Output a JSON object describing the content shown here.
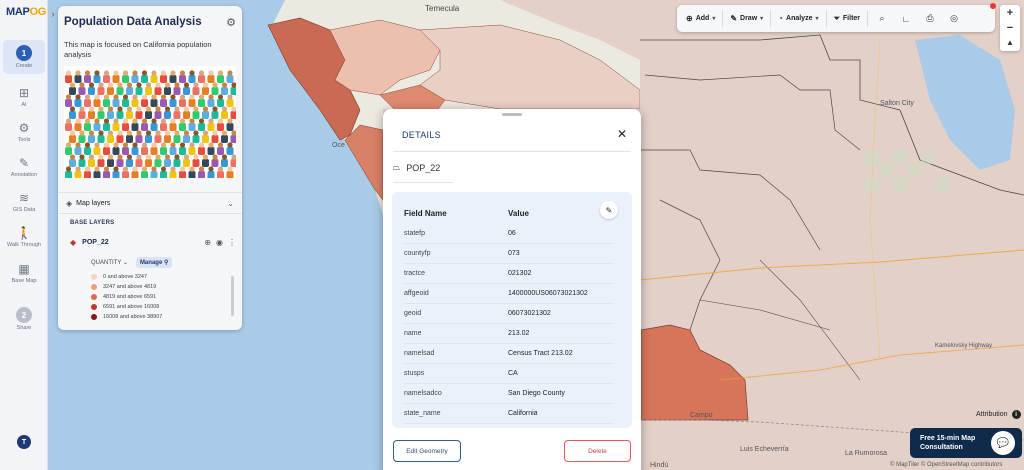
{
  "app": {
    "logo_main": "MAP",
    "logo_accent": "OG"
  },
  "rail": {
    "expand_icon": "chevron-right-icon",
    "items": [
      {
        "label": "Create",
        "step": "1"
      },
      {
        "label": "AI"
      },
      {
        "label": "Tools"
      },
      {
        "label": "Annotation"
      },
      {
        "label": "GIS Data"
      },
      {
        "label": "Walk Through"
      },
      {
        "label": "Base Map"
      },
      {
        "label": "Share",
        "step": "2"
      }
    ],
    "user_initial": "T"
  },
  "panel": {
    "title": "Population Data Analysis",
    "description": "This map is focused on California population analysis",
    "map_layers_label": "Map layers",
    "base_layers_label": "BASE LAYERS",
    "layer_name": "POP_22",
    "style_mode": "QUANTITY",
    "manage_label": "Manage",
    "legend": [
      {
        "label": "0 and above 3247",
        "color": "#f6d4c6"
      },
      {
        "label": "3247 and above 4819",
        "color": "#ee9e80"
      },
      {
        "label": "4819 and above 6591",
        "color": "#df6a4c"
      },
      {
        "label": "6591 and above 16008",
        "color": "#c0392b"
      },
      {
        "label": "16008 and above 38907",
        "color": "#8e1515"
      }
    ]
  },
  "toolbar": {
    "add_label": "Add",
    "draw_label": "Draw",
    "analyze_label": "Analyze",
    "filter_label": "Filter"
  },
  "zoom": {
    "in": "+",
    "out": "−"
  },
  "map_labels": {
    "temecula": "Temecula",
    "salton_city": "Salton City",
    "kamelovsky": "Kamelovsky Highway",
    "campo": "Campo",
    "luis_echeverria": "Luis Echeverría",
    "la_rumorosa": "La Rumorosa",
    "hindu": "Hindú",
    "oce": "Oce"
  },
  "details": {
    "title": "DETAILS",
    "feature_name": "POP_22",
    "col_field": "Field Name",
    "col_value": "Value",
    "rows": [
      {
        "field": "statefp",
        "value": "06"
      },
      {
        "field": "countyfp",
        "value": "073"
      },
      {
        "field": "tractce",
        "value": "021302"
      },
      {
        "field": "affgeoid",
        "value": "1400000US06073021302"
      },
      {
        "field": "geoid",
        "value": "06073021302"
      },
      {
        "field": "name",
        "value": "213.02"
      },
      {
        "field": "namelsad",
        "value": "Census Tract 213.02"
      },
      {
        "field": "stusps",
        "value": "CA"
      },
      {
        "field": "namelsadco",
        "value": "San Diego County"
      },
      {
        "field": "state_name",
        "value": "California"
      }
    ],
    "edit_geometry_label": "Edit Geometry",
    "delete_label": "Delete"
  },
  "attribution_label": "Attribution",
  "consult": {
    "line1": "Free 15-min Map",
    "line2": "Consultation"
  },
  "credits": "© MapTiler © OpenStreetMap contributors"
}
